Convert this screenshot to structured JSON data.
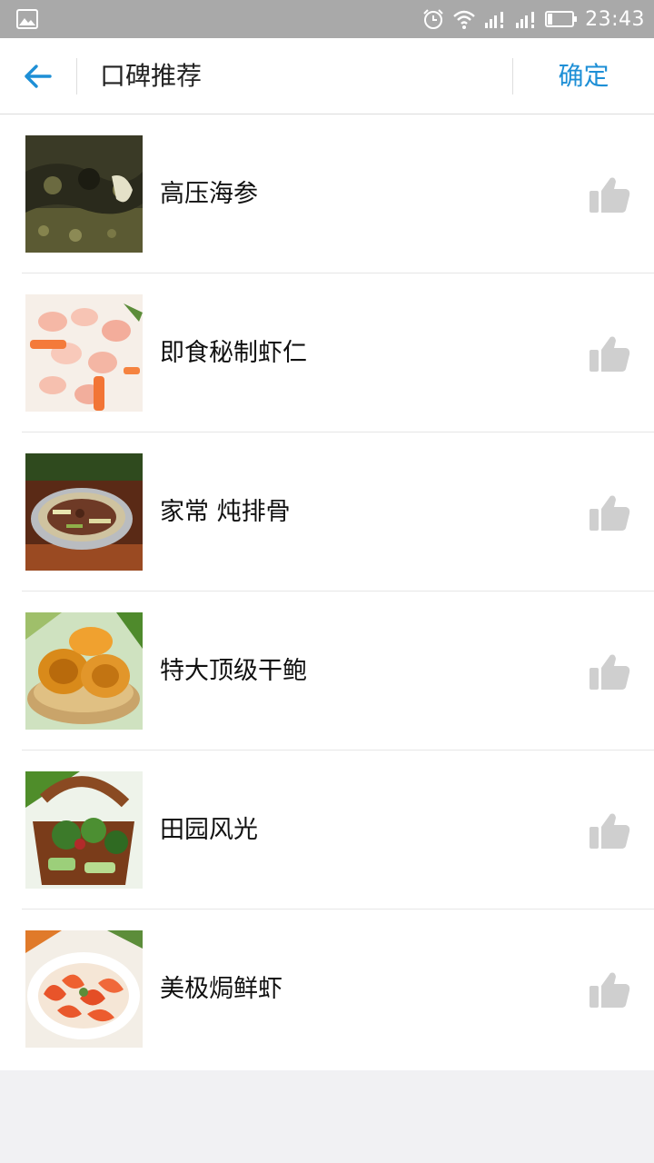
{
  "status_bar": {
    "time": "23:43",
    "icons": [
      "gallery-icon",
      "alarm-icon",
      "wifi-icon",
      "signal-icon",
      "signal-icon",
      "battery-icon"
    ]
  },
  "app_bar": {
    "back_icon": "arrow-left-icon",
    "title": "口碑推荐",
    "confirm_label": "确定"
  },
  "colors": {
    "accent": "#1e8fd6",
    "status_bar_bg": "#a9a9a9",
    "like_icon": "#cfcfcf"
  },
  "dishes": [
    {
      "name": "高压海参",
      "thumb_icon": "sea-cucumber-photo",
      "like_icon": "thumbs-up-icon"
    },
    {
      "name": "即食秘制虾仁",
      "thumb_icon": "shrimp-photo",
      "like_icon": "thumbs-up-icon"
    },
    {
      "name": "家常 炖排骨",
      "thumb_icon": "stewed-ribs-photo",
      "like_icon": "thumbs-up-icon"
    },
    {
      "name": "特大顶级干鲍",
      "thumb_icon": "abalone-photo",
      "like_icon": "thumbs-up-icon"
    },
    {
      "name": "田园风光",
      "thumb_icon": "vegetable-basket-photo",
      "like_icon": "thumbs-up-icon"
    },
    {
      "name": "美极焗鲜虾",
      "thumb_icon": "baked-prawn-photo",
      "like_icon": "thumbs-up-icon"
    }
  ]
}
